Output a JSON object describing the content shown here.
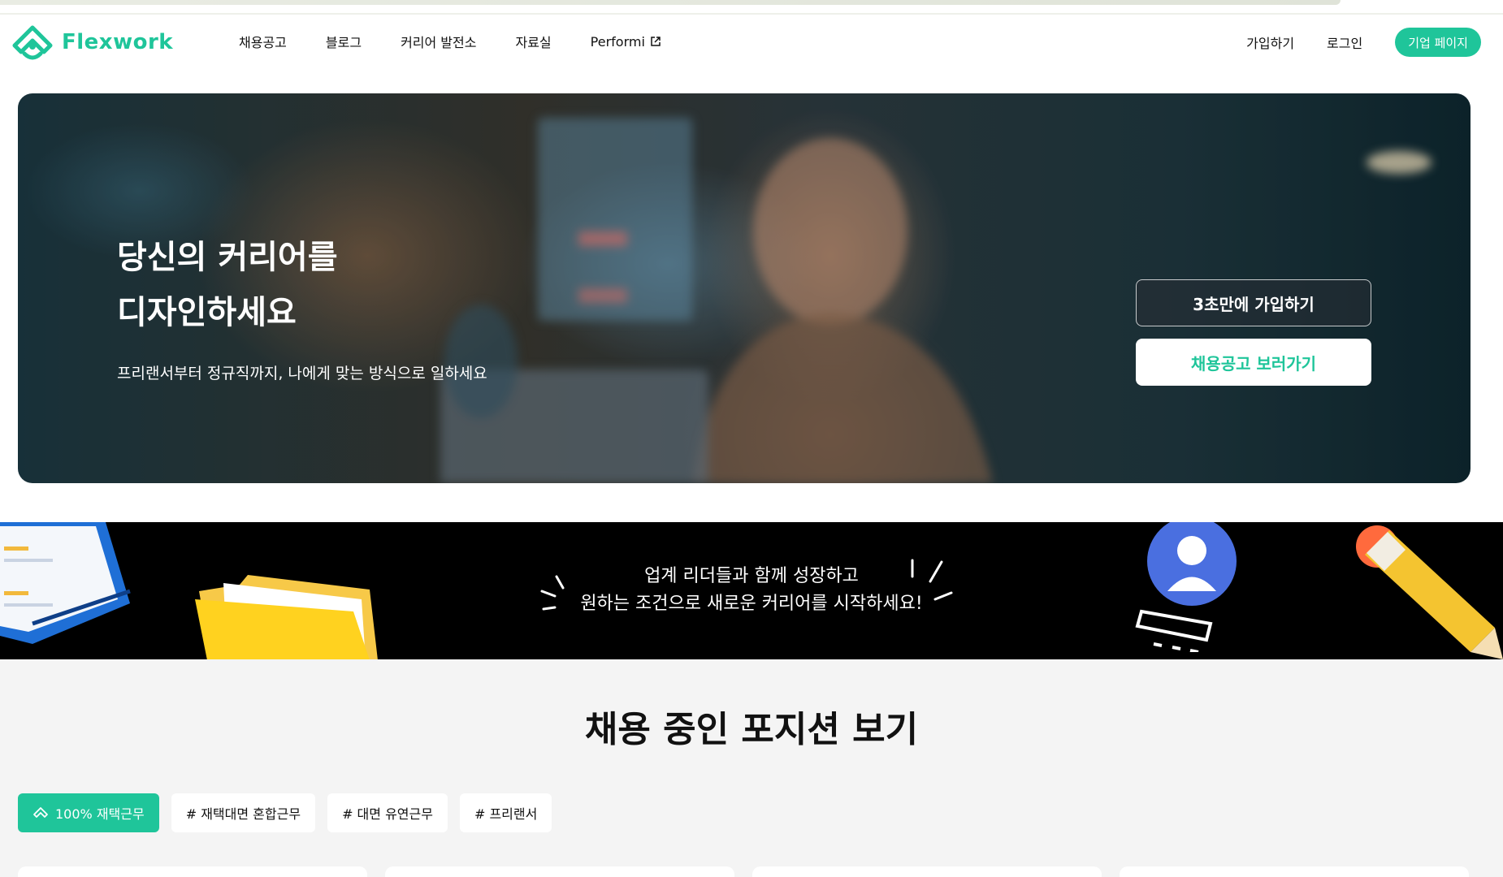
{
  "brand": {
    "name": "Flexwork",
    "accent": "#1fc59a"
  },
  "nav": {
    "items": [
      {
        "label": "채용공고"
      },
      {
        "label": "블로그"
      },
      {
        "label": "커리어 발전소"
      },
      {
        "label": "자료실"
      },
      {
        "label": "Performi",
        "icon": "external-link-icon"
      }
    ],
    "signup_label": "가입하기",
    "login_label": "로그인",
    "company_label": "기업 페이지"
  },
  "hero": {
    "title_line1": "당신의 커리어를",
    "title_line2": "디자인하세요",
    "subtitle": "프리랜서부터 정규직까지, 나에게 맞는 방식으로 일하세요",
    "signup_button": "3초만에 가입하기",
    "jobs_button": "채용공고 보러가기"
  },
  "banner": {
    "line1": "업계 리더들과 함께 성장하고",
    "line2": "원하는 조건으로 새로운 커리어를 시작하세요!"
  },
  "positions": {
    "title": "채용 중인 포지션 보기",
    "filters": [
      {
        "label": "100% 재택근무",
        "active": true,
        "icon": "remote-home-icon"
      },
      {
        "label": "# 재택대면 혼합근무",
        "active": false
      },
      {
        "label": "# 대면 유연근무",
        "active": false
      },
      {
        "label": "# 프리랜서",
        "active": false
      }
    ]
  }
}
